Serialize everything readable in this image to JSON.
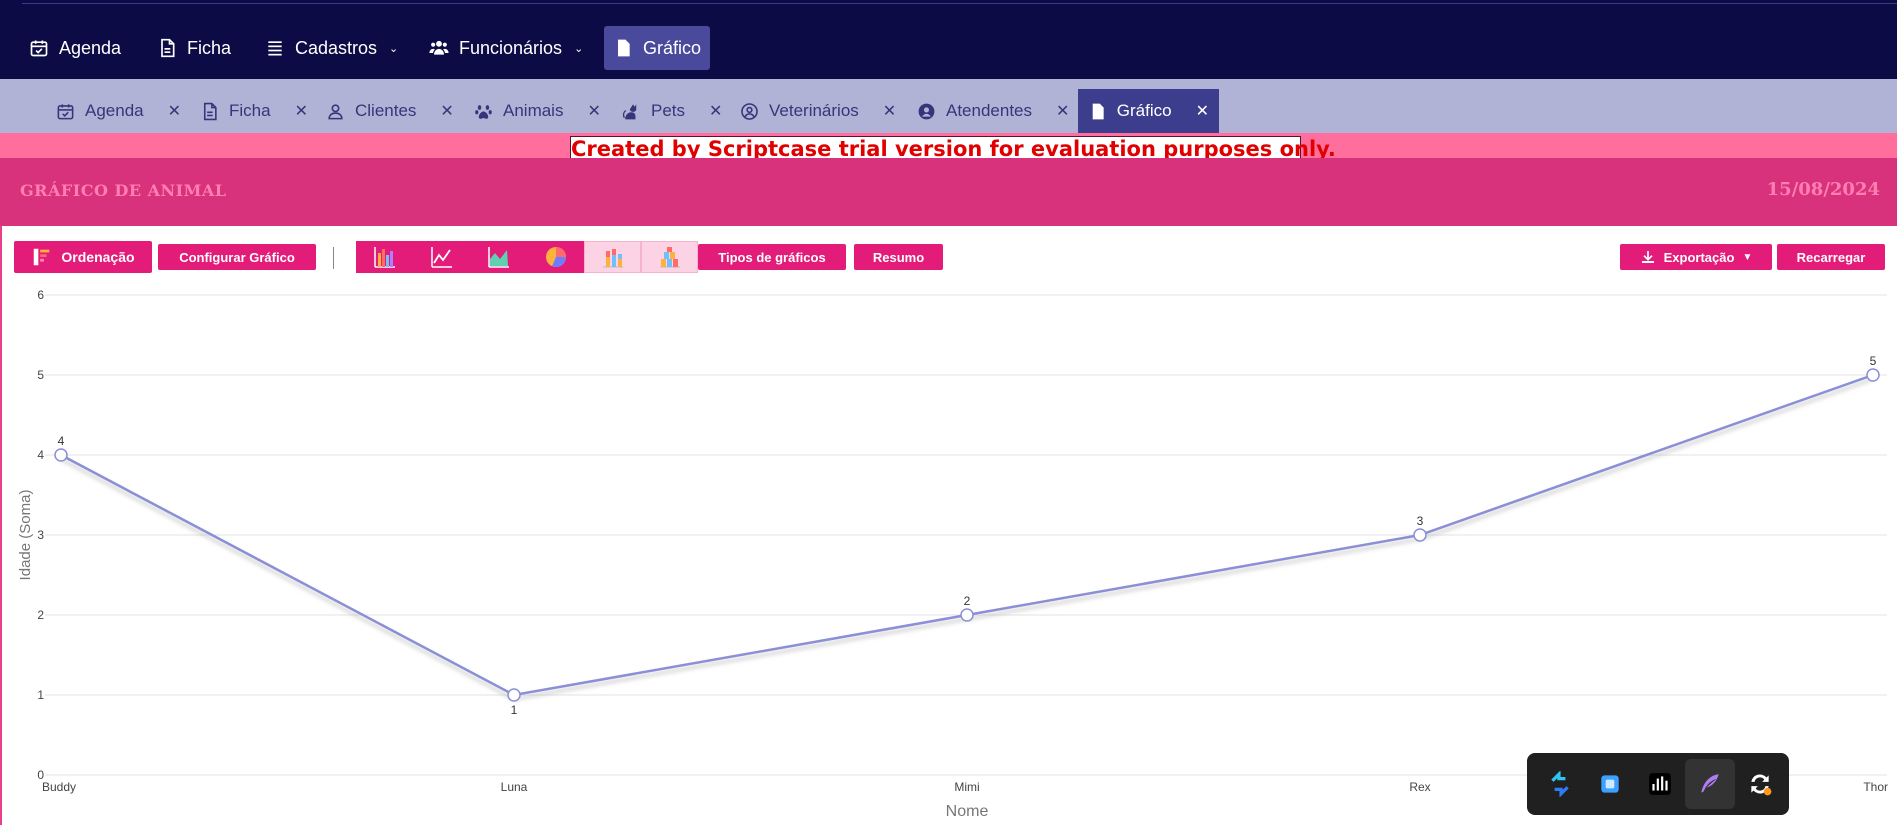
{
  "topnav": {
    "items": [
      {
        "label": "Agenda",
        "icon": "calendar-check-icon"
      },
      {
        "label": "Ficha",
        "icon": "file-icon"
      },
      {
        "label": "Cadastros",
        "icon": "list-icon",
        "dropdown": true
      },
      {
        "label": "Funcionários",
        "icon": "users-icon",
        "dropdown": true
      },
      {
        "label": "Gráfico",
        "icon": "file-icon",
        "active": true
      }
    ]
  },
  "tabs": [
    {
      "label": "Agenda",
      "icon": "calendar-check-icon"
    },
    {
      "label": "Ficha",
      "icon": "file-icon"
    },
    {
      "label": "Clientes",
      "icon": "user-icon"
    },
    {
      "label": "Animais",
      "icon": "paw-icon"
    },
    {
      "label": "Pets",
      "icon": "cat-icon"
    },
    {
      "label": "Veterinários",
      "icon": "user-circle-icon"
    },
    {
      "label": "Atendentes",
      "icon": "user-circle-filled-icon"
    },
    {
      "label": "Gráfico",
      "icon": "file-icon",
      "active": true
    }
  ],
  "trial_notice": "Created by Scriptcase trial version for evaluation purposes only.",
  "header": {
    "title": "GRÁFICO DE ANIMAL",
    "date": "15/08/2024"
  },
  "toolbar": {
    "ordenacao": "Ordenação",
    "configurar": "Configurar Gráfico",
    "tipos": "Tipos de gráficos",
    "resumo": "Resumo",
    "exportacao": "Exportação",
    "recarregar": "Recarregar",
    "chart_type_buttons": [
      "bar-chart-icon",
      "line-chart-icon",
      "area-chart-icon",
      "pie-chart-icon",
      "stacked-bar-icon",
      "grouped-bar-icon"
    ]
  },
  "chart_data": {
    "type": "line",
    "categories": [
      "Buddy",
      "Luna",
      "Mimi",
      "Rex",
      "Thor"
    ],
    "series": [
      {
        "values": [
          4,
          1,
          2,
          3,
          5
        ]
      }
    ],
    "xlabel": "Nome",
    "ylabel": "Idade (Soma)",
    "ylim": [
      0,
      6
    ],
    "yticks": [
      0,
      1,
      2,
      3,
      4,
      5,
      6
    ],
    "grid": true,
    "line_color": "#8b8fd6"
  },
  "taskbar": {
    "icons": [
      "sync-arrows-icon",
      "square-app-icon",
      "audio-bars-icon",
      "feather-icon",
      "refresh-icon"
    ]
  }
}
